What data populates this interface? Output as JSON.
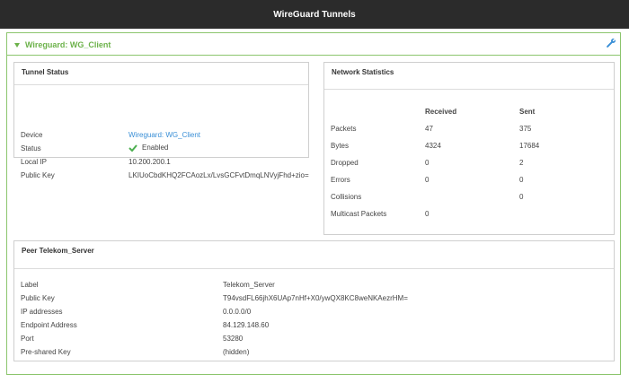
{
  "header": {
    "title": "WireGuard Tunnels"
  },
  "section": {
    "title": "Wireguard: WG_Client"
  },
  "tunnel_status": {
    "title": "Tunnel Status",
    "rows": [
      {
        "label": "Device",
        "value": "Wireguard: WG_Client"
      },
      {
        "label": "Status",
        "value": "Enabled"
      },
      {
        "label": "Local IP",
        "value": "10.200.200.1"
      },
      {
        "label": "Public Key",
        "value": "LKIUoCbdKHQ2FCAozLx/LvsGCFvtDmqLNVyjFhd+zio="
      }
    ]
  },
  "network_statistics": {
    "title": "Network Statistics",
    "headers": {
      "received": "Received",
      "sent": "Sent"
    },
    "rows": [
      {
        "label": "Packets",
        "received": "47",
        "sent": "375"
      },
      {
        "label": "Bytes",
        "received": "4324",
        "sent": "17684"
      },
      {
        "label": "Dropped",
        "received": "0",
        "sent": "2"
      },
      {
        "label": "Errors",
        "received": "0",
        "sent": "0"
      },
      {
        "label": "Collisions",
        "received": "",
        "sent": "0"
      },
      {
        "label": "Multicast Packets",
        "received": "0",
        "sent": ""
      }
    ]
  },
  "peer": {
    "title": "Peer Telekom_Server",
    "rows": [
      {
        "label": "Label",
        "value": "Telekom_Server"
      },
      {
        "label": "Public Key",
        "value": "T94vsdFL66jhX6UAp7nHf+X0/ywQX8KC8weNKAezrHM="
      },
      {
        "label": "IP addresses",
        "value": "0.0.0.0/0"
      },
      {
        "label": "Endpoint Address",
        "value": "84.129.148.60"
      },
      {
        "label": "Port",
        "value": "53280"
      },
      {
        "label": "Pre-shared Key",
        "value": "(hidden)"
      }
    ]
  },
  "colors": {
    "accent": "#6cb24a",
    "link": "#3a8fd6",
    "header_bg": "#2b2b2b"
  },
  "icons": {
    "section_toggle": "caret-down-icon",
    "edit": "wrench-icon",
    "status": "check-icon"
  }
}
